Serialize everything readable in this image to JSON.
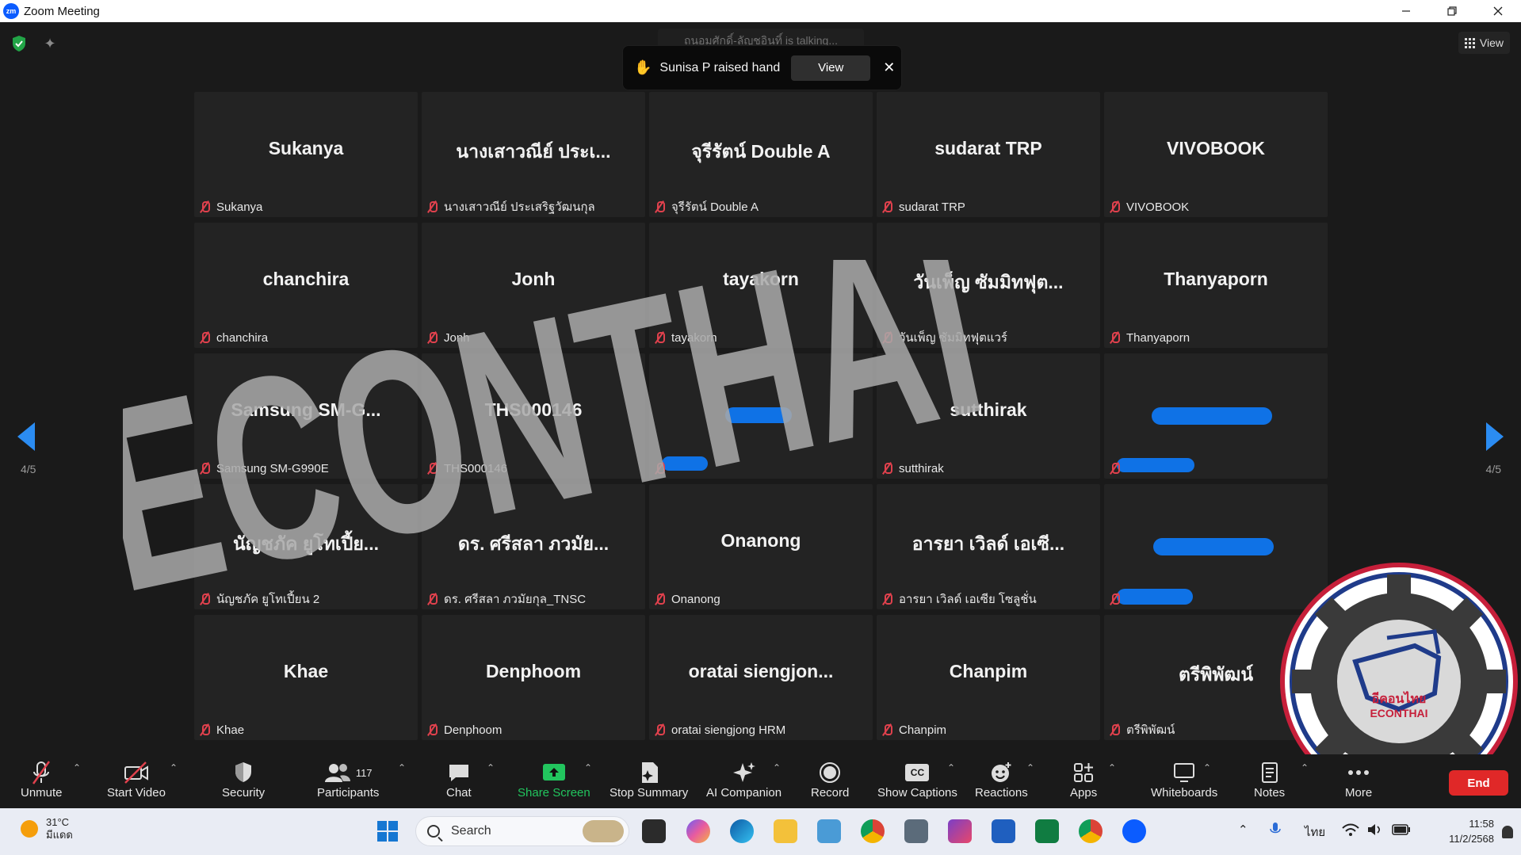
{
  "window": {
    "title": "Zoom Meeting",
    "app_icon": "zm"
  },
  "top": {
    "view_label": "View",
    "talking_text": "ถนอมศักดิ์-ลัญชอินทิ์ is talking..."
  },
  "notification": {
    "text": "Sunisa P raised hand",
    "view_label": "View",
    "close_glyph": "✕",
    "hand_glyph": "✋"
  },
  "tiles": [
    {
      "title": "Sukanya",
      "name": "Sukanya"
    },
    {
      "title": "นางเสาวณีย์ ประเ...",
      "name": "นางเสาวณีย์ ประเสริฐวัฒนกุล"
    },
    {
      "title": "จุรีรัตน์ Double A",
      "name": "จุรีรัตน์ Double A"
    },
    {
      "title": "sudarat TRP",
      "name": "sudarat TRP"
    },
    {
      "title": "VIVOBOOK",
      "name": "VIVOBOOK"
    },
    {
      "title": "chanchira",
      "name": "chanchira"
    },
    {
      "title": "Jonh",
      "name": "Jonh"
    },
    {
      "title": "tayakorn",
      "name": "tayakorn"
    },
    {
      "title": "วันเพ็ญ ซัมมิทฟุต...",
      "name": "วันเพ็ญ ซัมมิทฟุตแวร์"
    },
    {
      "title": "Thanyaporn",
      "name": "Thanyaporn"
    },
    {
      "title": "Samsung SM-G...",
      "name": "Samsung SM-G990E"
    },
    {
      "title": "THS000146",
      "name": "THS000146"
    },
    {
      "title": "",
      "name": ""
    },
    {
      "title": "sutthirak",
      "name": "sutthirak"
    },
    {
      "title": "",
      "name": ""
    },
    {
      "title": "นัญชภัค ยูโทเปี้ย...",
      "name": "นัญชภัค ยูโทเปี้ยน 2"
    },
    {
      "title": "ดร. ศรีสลา ภวมัย...",
      "name": "ดร. ศรีสลา ภวมัยกุล_TNSC"
    },
    {
      "title": "Onanong",
      "name": "Onanong"
    },
    {
      "title": "อารยา เวิลด์ เอเซี...",
      "name": "อารยา เวิลด์ เอเซีย โซลูชั่น"
    },
    {
      "title": "",
      "name": ""
    },
    {
      "title": "Khae",
      "name": "Khae"
    },
    {
      "title": "Denphoom",
      "name": "Denphoom"
    },
    {
      "title": "oratai siengjon...",
      "name": "oratai siengjong HRM"
    },
    {
      "title": "Chanpim",
      "name": "Chanpim"
    },
    {
      "title": "ตรีพิพัฒน์",
      "name": "ตรีพิพัฒน์"
    }
  ],
  "pagination": {
    "left": "4/5",
    "right": "4/5"
  },
  "watermark": {
    "text": "ECONTHAI",
    "seal_th": "อีคอนไทย",
    "seal_en": "ECONTHAI"
  },
  "toolbar": {
    "unmute": "Unmute",
    "start_video": "Start Video",
    "security": "Security",
    "participants": "Participants",
    "participants_count": "117",
    "chat": "Chat",
    "share_screen": "Share Screen",
    "stop_summary": "Stop Summary",
    "ai_companion": "AI Companion",
    "record": "Record",
    "show_captions": "Show Captions",
    "reactions": "Reactions",
    "apps": "Apps",
    "whiteboards": "Whiteboards",
    "notes": "Notes",
    "more": "More",
    "end": "End",
    "captions_badge": "CC"
  },
  "taskbar": {
    "weather_temp": "31°C",
    "weather_desc": "มีแดด",
    "search_label": "Search",
    "language": "ไทย",
    "time": "11:58",
    "date": "11/2/2568"
  },
  "colors": {
    "accent": "#2b8cf2",
    "share_green": "#22c55e",
    "end_red": "#e02828",
    "mic_off": "#e0414d"
  }
}
